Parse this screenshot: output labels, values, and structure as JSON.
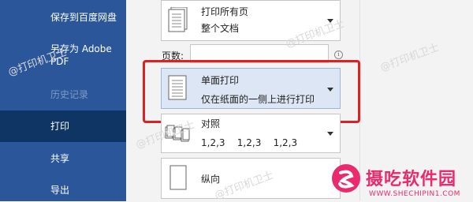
{
  "sidebar": {
    "items": [
      {
        "label": "保存到百度网盘"
      },
      {
        "label": "另存为 Adobe PDF"
      },
      {
        "label": "历史记录"
      },
      {
        "label": "打印"
      },
      {
        "label": "共享"
      },
      {
        "label": "导出"
      }
    ]
  },
  "print": {
    "pages_label": "页数:",
    "pages_value": "",
    "range": {
      "title": "打印所有页",
      "subtitle": "整个文档"
    },
    "sides": {
      "title": "单面打印",
      "subtitle": "仅在纸面的一侧上进行打印"
    },
    "collate": {
      "title": "对照",
      "subtitle": "1,2,3    1,2,3    1,2,3"
    },
    "orientation": {
      "title": "纵向"
    }
  },
  "watermark": "@打印机卫士",
  "logo": {
    "title": "摄吃软件园",
    "url": "WWW.SHECHIPIN1.COM"
  },
  "colors": {
    "sidebar": "#2b579a",
    "sidebar_active": "#0f3565",
    "highlight": "#e02020",
    "brand": "#ea2a6c"
  }
}
